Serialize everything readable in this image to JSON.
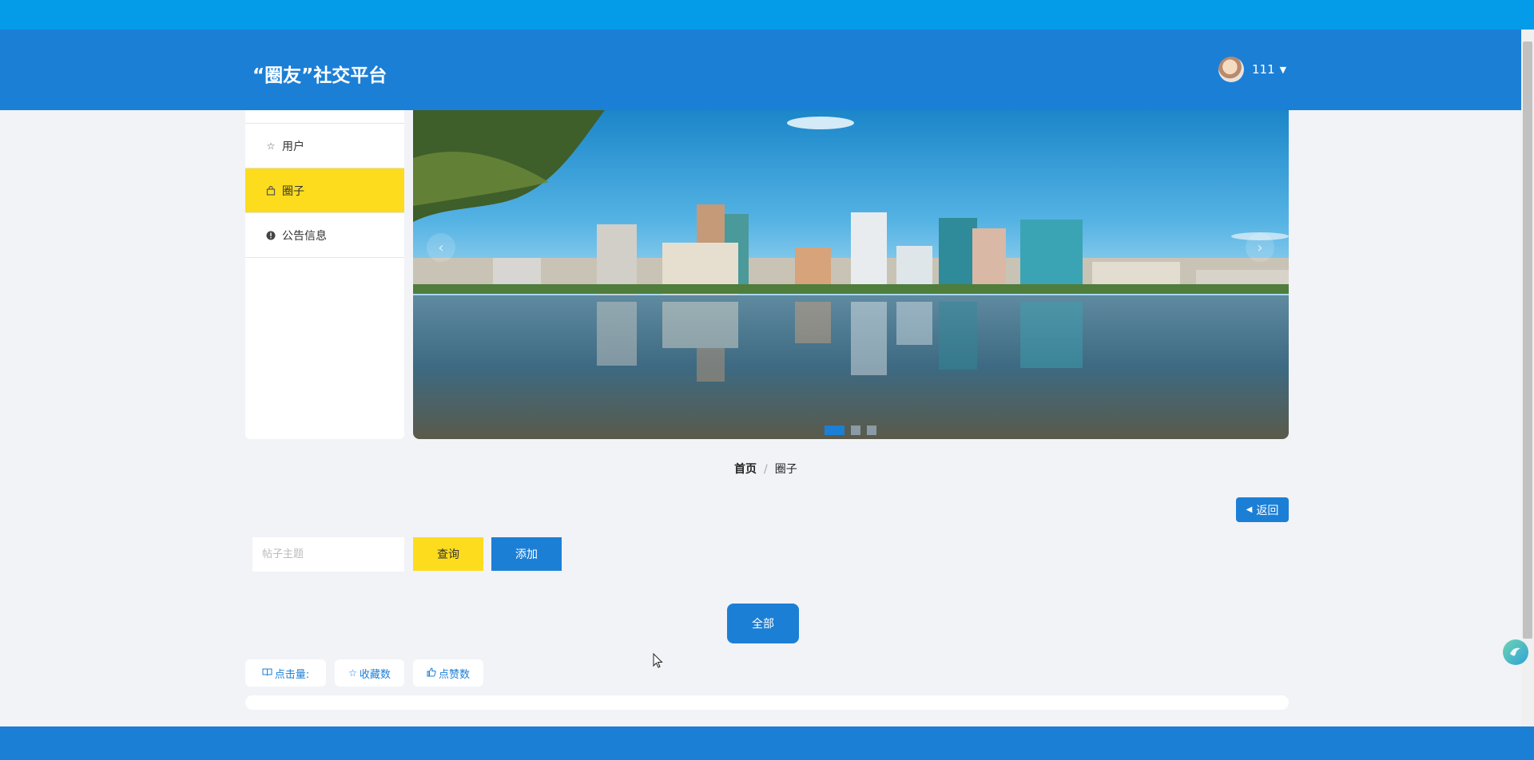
{
  "header": {
    "brand": "“圈友”社交平台",
    "username": "111"
  },
  "sidebar": {
    "items": [
      {
        "label": "用户",
        "icon": "star-outline-icon",
        "active": false
      },
      {
        "label": "圈子",
        "icon": "bag-icon",
        "active": true
      },
      {
        "label": "公告信息",
        "icon": "exclamation-circle-icon",
        "active": false
      }
    ]
  },
  "carousel": {
    "slides": 3,
    "active_slide": 1,
    "prev_glyph": "‹",
    "next_glyph": "›"
  },
  "breadcrumb": {
    "home": "首页",
    "separator": "/",
    "current": "圈子"
  },
  "back_button": "返回",
  "search": {
    "placeholder": "帖子主题",
    "query_label": "查询",
    "add_label": "添加"
  },
  "filter": {
    "all_label": "全部"
  },
  "sort": {
    "clicks": "点击量:",
    "favorites": "收藏数",
    "likes": "点赞数"
  },
  "colors": {
    "primary": "#1c7fd6",
    "accent": "#fddc1e",
    "top_strip": "#049be8",
    "page_bg": "#f2f3f7"
  }
}
